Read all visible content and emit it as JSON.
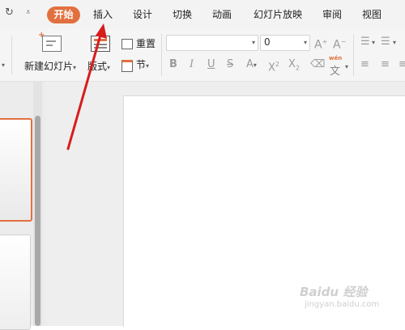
{
  "menubar": {
    "undo_icon": "redo-arrow-icon",
    "more_icon": "chevron-down-icon",
    "start_label": "开始",
    "tabs": [
      "插入",
      "设计",
      "切换",
      "动画",
      "幻灯片放映",
      "审阅",
      "视图"
    ],
    "accent_color": "#e2703f"
  },
  "ribbon": {
    "new_slide_label": "新建幻灯片",
    "layout_label": "版式",
    "reset_label": "重置",
    "section_label": "节",
    "font_size_value": "0"
  },
  "watermark": {
    "title": "Baidu 经验",
    "url": "jingyan.baidu.com"
  }
}
